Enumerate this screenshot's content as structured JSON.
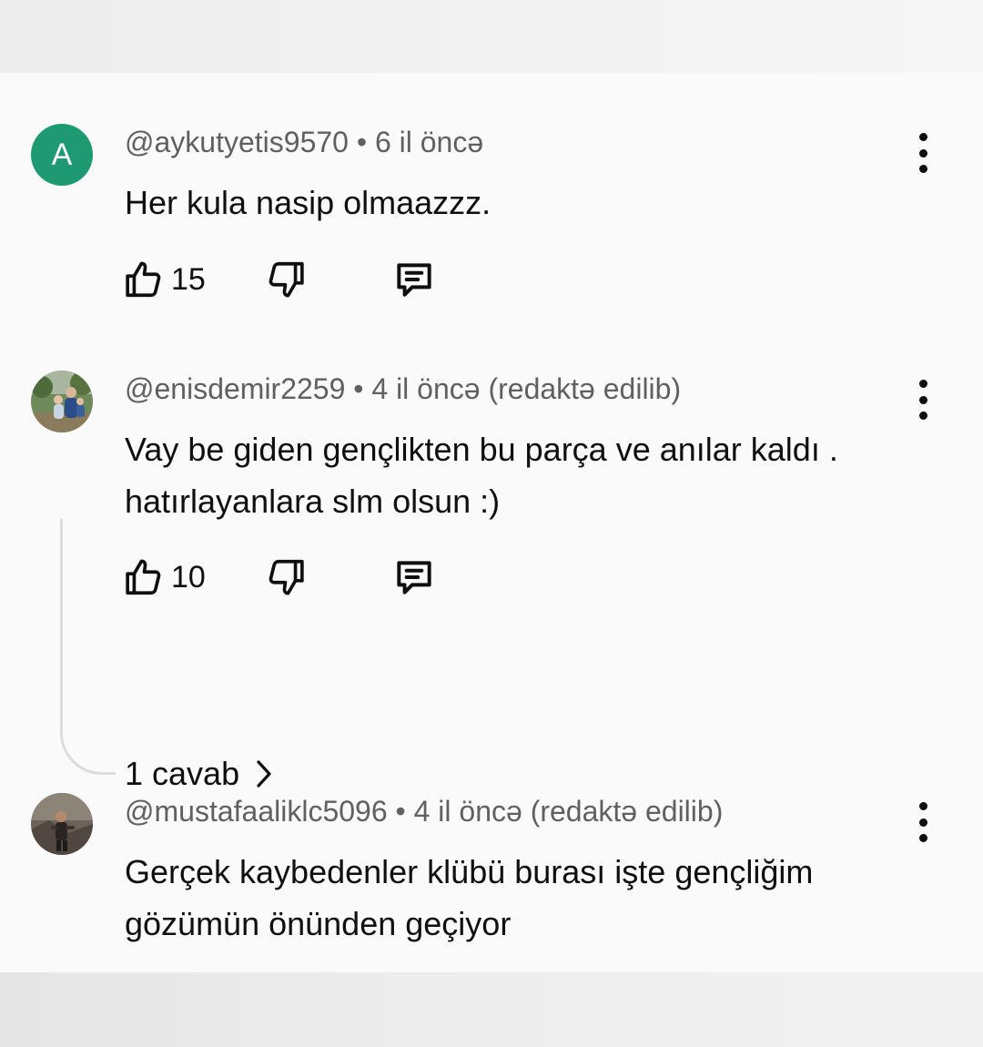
{
  "comments": [
    {
      "avatar": {
        "type": "letter",
        "letter": "A",
        "color": "#1e9a73"
      },
      "author": "@aykutyetis9570",
      "meta": "• 6 il öncə",
      "text_lines": [
        "Her kula nasip olmaazzz."
      ],
      "likes": "15"
    },
    {
      "avatar": {
        "type": "photo",
        "description_icon": "family-photo-avatar"
      },
      "author": "@enisdemir2259",
      "meta": "• 4 il öncə (redaktə edilib)",
      "text_lines": [
        "Vay be giden gençlikten bu parça ve anılar kaldı .",
        "hatırlayanlara slm olsun :)"
      ],
      "likes": "10",
      "replies": "1 cavab"
    },
    {
      "avatar": {
        "type": "photo",
        "description_icon": "person-photo-avatar"
      },
      "author": "@mustafaaliklc5096",
      "meta": "• 4 il öncə (redaktə edilib)",
      "text_lines": [
        "Gerçek kaybedenler klübü burası işte gençliğim",
        "gözümün önünden geçiyor"
      ]
    }
  ],
  "icons": {
    "like": "thumb-up-icon",
    "dislike": "thumb-down-icon",
    "reply": "comment-reply-icon",
    "menu": "more-vertical-icon",
    "chevron": "chevron-right-icon"
  },
  "colors": {
    "text": "#0f0f0f",
    "meta": "#606060",
    "avatar_letter_bg": "#1e9a73",
    "background": "#fafafa"
  }
}
